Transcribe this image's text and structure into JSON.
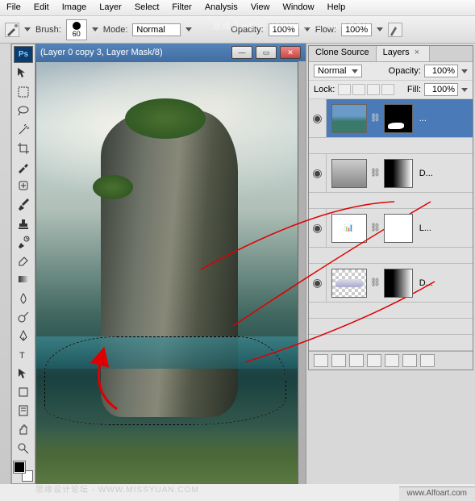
{
  "menu": [
    "File",
    "Edit",
    "Image",
    "Layer",
    "Select",
    "Filter",
    "Analysis",
    "View",
    "Window",
    "Help"
  ],
  "options": {
    "brush_label": "Brush:",
    "brush_size": "60",
    "mode_label": "Mode:",
    "mode_value": "Normal",
    "opacity_label": "Opacity:",
    "opacity_value": "100%",
    "flow_label": "Flow:",
    "flow_value": "100%"
  },
  "doc": {
    "title": "(Layer 0 copy 3, Layer Mask/8)"
  },
  "panel": {
    "tabs": {
      "clone": "Clone Source",
      "layers": "Layers"
    },
    "blend_mode": "Normal",
    "opacity_label": "Opacity:",
    "opacity_value": "100%",
    "lock_label": "Lock:",
    "fill_label": "Fill:",
    "fill_value": "100%",
    "layers": [
      {
        "name": "...",
        "selected": true
      },
      {
        "name": "D...",
        "selected": false
      },
      {
        "name": "L...",
        "selected": false
      },
      {
        "name": "D...",
        "selected": false
      }
    ]
  },
  "watermarks": {
    "top": "思缘设计论坛 WWW.MISSYUAN.COM",
    "bottom": "思缘设计论坛 - WWW.MISSYUAN.COM"
  },
  "status": {
    "credit": "www.Alfoart.com"
  }
}
